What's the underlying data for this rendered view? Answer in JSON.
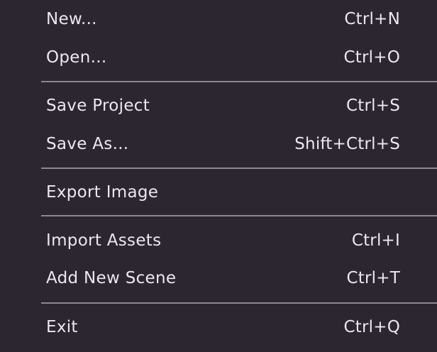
{
  "menu": {
    "items": [
      {
        "label": "New...",
        "shortcut": "Ctrl+N"
      },
      {
        "label": "Open...",
        "shortcut": "Ctrl+O"
      },
      {
        "label": "Save Project",
        "shortcut": "Ctrl+S"
      },
      {
        "label": "Save As...",
        "shortcut": "Shift+Ctrl+S"
      },
      {
        "label": "Export Image",
        "shortcut": ""
      },
      {
        "label": "Import Assets",
        "shortcut": "Ctrl+I"
      },
      {
        "label": "Add New Scene",
        "shortcut": "Ctrl+T"
      },
      {
        "label": "Exit",
        "shortcut": "Ctrl+Q"
      }
    ]
  },
  "colors": {
    "background": "#2b2630",
    "text": "#ebe8ee",
    "separator": "#8c8791"
  }
}
